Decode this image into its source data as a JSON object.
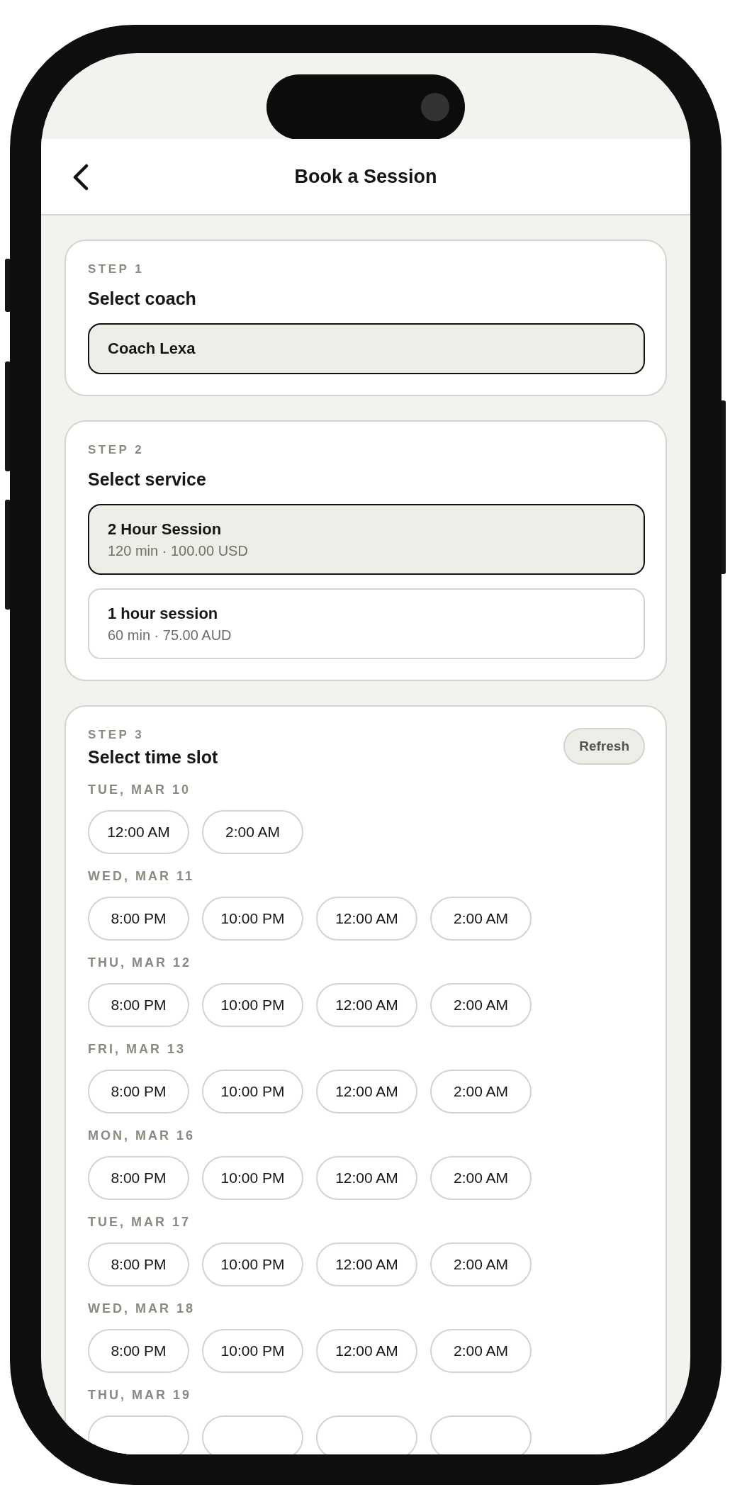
{
  "header": {
    "title": "Book a Session"
  },
  "steps": [
    {
      "kind": "coach",
      "step": "STEP 1",
      "title": "Select coach",
      "options": [
        {
          "name": "Coach Lexa",
          "selected": true
        }
      ]
    },
    {
      "kind": "service",
      "step": "STEP 2",
      "title": "Select service",
      "options": [
        {
          "name": "2 Hour Session",
          "detail": "120 min · 100.00 USD",
          "selected": true
        },
        {
          "name": "1 hour session",
          "detail": "60 min · 75.00 AUD",
          "selected": false
        }
      ]
    },
    {
      "kind": "slots",
      "step": "STEP 3",
      "title": "Select time slot",
      "action": "Refresh",
      "days": [
        {
          "label": "TUE, MAR 10",
          "slots": [
            {
              "time": "12:00 AM",
              "selected": false
            },
            {
              "time": "2:00 AM",
              "selected": false
            }
          ]
        },
        {
          "label": "WED, MAR 11",
          "slots": [
            {
              "time": "8:00 PM",
              "selected": false
            },
            {
              "time": "10:00 PM",
              "selected": false
            },
            {
              "time": "12:00 AM",
              "selected": false
            },
            {
              "time": "2:00 AM",
              "selected": false
            }
          ]
        },
        {
          "label": "THU, MAR 12",
          "slots": [
            {
              "time": "8:00 PM",
              "selected": false
            },
            {
              "time": "10:00 PM",
              "selected": false
            },
            {
              "time": "12:00 AM",
              "selected": false
            },
            {
              "time": "2:00 AM",
              "selected": false
            }
          ]
        },
        {
          "label": "FRI, MAR 13",
          "slots": [
            {
              "time": "8:00 PM",
              "selected": false
            },
            {
              "time": "10:00 PM",
              "selected": false
            },
            {
              "time": "12:00 AM",
              "selected": false
            },
            {
              "time": "2:00 AM",
              "selected": false
            }
          ]
        },
        {
          "label": "MON, MAR 16",
          "slots": [
            {
              "time": "8:00 PM",
              "selected": false
            },
            {
              "time": "10:00 PM",
              "selected": false
            },
            {
              "time": "12:00 AM",
              "selected": false
            },
            {
              "time": "2:00 AM",
              "selected": false
            }
          ]
        },
        {
          "label": "TUE, MAR 17",
          "slots": [
            {
              "time": "8:00 PM",
              "selected": false
            },
            {
              "time": "10:00 PM",
              "selected": false
            },
            {
              "time": "12:00 AM",
              "selected": false
            },
            {
              "time": "2:00 AM",
              "selected": false
            }
          ]
        },
        {
          "label": "WED, MAR 18",
          "slots": [
            {
              "time": "8:00 PM",
              "selected": false
            },
            {
              "time": "10:00 PM",
              "selected": false
            },
            {
              "time": "12:00 AM",
              "selected": false
            },
            {
              "time": "2:00 AM",
              "selected": false
            }
          ]
        },
        {
          "label": "THU, MAR 19",
          "slots": [
            {
              "selected": false
            },
            {
              "selected": false
            },
            {
              "selected": false
            },
            {
              "selected": false
            }
          ]
        }
      ]
    }
  ]
}
